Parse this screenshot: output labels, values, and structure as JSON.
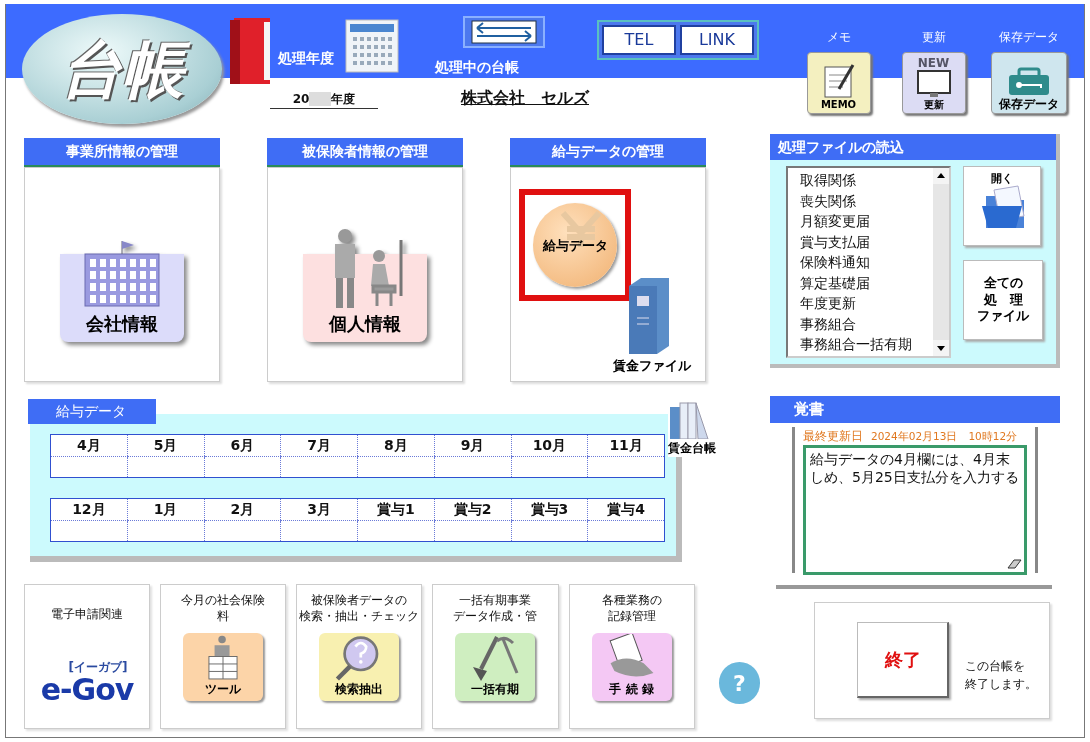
{
  "header": {
    "logo": "台帳",
    "year_label": "処理年度",
    "year_prefix": "20",
    "year_suffix": "年度",
    "current_label": "処理中の台帳",
    "company": "株式会社　セルズ",
    "link_buttons": [
      "TEL",
      "LINK"
    ],
    "tools": [
      {
        "kind": "memo",
        "caption": "メモ",
        "icon_label": "MEMO"
      },
      {
        "kind": "update",
        "caption": "更新",
        "icon_label": "更新",
        "badge": "NEW"
      },
      {
        "kind": "save",
        "caption": "保存データ",
        "icon_label": "保存データ"
      }
    ]
  },
  "panels": [
    {
      "kind": "company",
      "title": "事業所情報の管理",
      "button": "会社情報",
      "highlighted": false
    },
    {
      "kind": "person",
      "title": "被保険者情報の管理",
      "button": "個人情報",
      "highlighted": false
    },
    {
      "kind": "salary",
      "title": "給与データの管理",
      "button": "給与データ",
      "highlighted": true,
      "file_label": "賃金ファイル"
    }
  ],
  "file_load": {
    "title": "処理ファイルの読込",
    "items": [
      "取得関係",
      "喪失関係",
      "月額変更届",
      "賞与支払届",
      "保険料通知",
      "算定基礎届",
      "年度更新",
      "事務組合",
      "事務組合一括有期"
    ],
    "open_button": "開く",
    "all_button": [
      "全ての",
      "処　理",
      "ファイル"
    ]
  },
  "salary_data": {
    "title": "給与データ",
    "rows": [
      [
        "4月",
        "5月",
        "6月",
        "7月",
        "8月",
        "9月",
        "10月",
        "11月"
      ],
      [
        "12月",
        "1月",
        "2月",
        "3月",
        "賞与1",
        "賞与2",
        "賞与3",
        "賞与4"
      ]
    ],
    "ledger_label": "賃金台帳"
  },
  "memo": {
    "title": "覚書",
    "updated_label": "最終更新日",
    "updated_value": "2024年02月13日　10時12分",
    "text": "給与データの4月欄には、4月末しめ、5月25日支払分を入力する"
  },
  "bottom_tools": [
    {
      "kind": "egov",
      "title": [
        "電子申請関連"
      ],
      "icon_label": "e-Gov",
      "tag": "[イーガブ]"
    },
    {
      "kind": "tool",
      "title": [
        "今月の社会保険",
        "料"
      ],
      "icon_label": "ツール"
    },
    {
      "kind": "search",
      "title": [
        "被保険者データの",
        "検索・抽出・チェック"
      ],
      "icon_label": "検索抽出"
    },
    {
      "kind": "shovel",
      "title": [
        "一括有期事業",
        "データ作成・管"
      ],
      "icon_label": "一括有期"
    },
    {
      "kind": "record",
      "title": [
        "各種業務の",
        "記録管理"
      ],
      "icon_label": "手 続 録"
    }
  ],
  "help_button": "?",
  "exit": {
    "button": "終了",
    "note": [
      "この台帳を",
      "終了します。"
    ]
  }
}
